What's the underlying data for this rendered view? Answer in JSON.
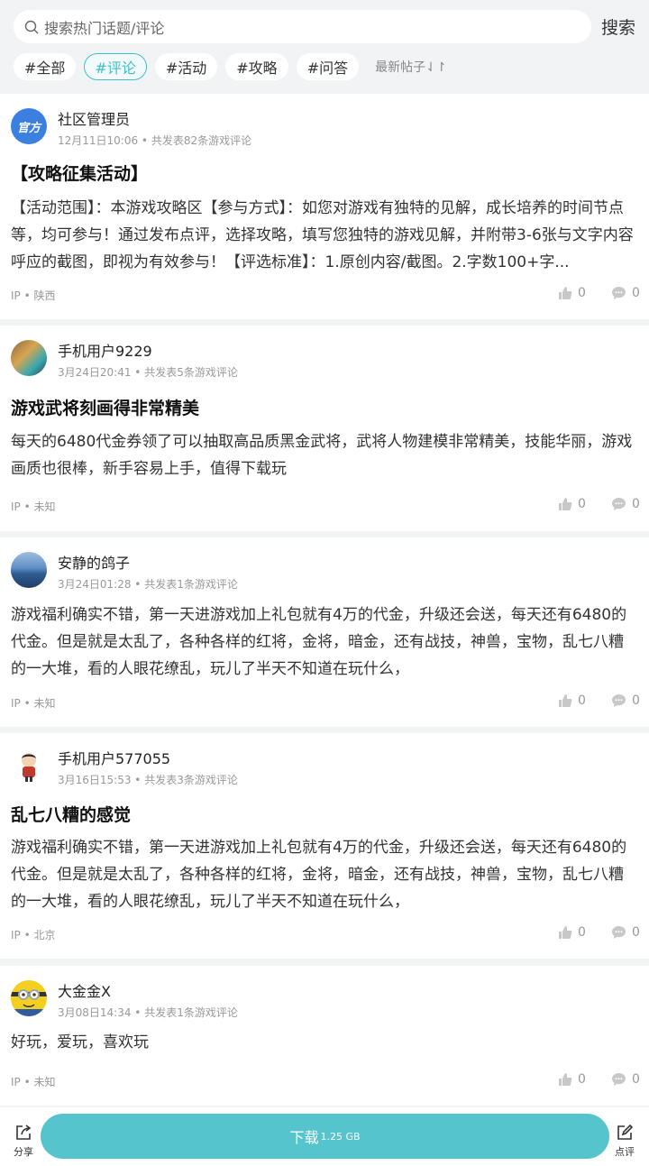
{
  "search": {
    "placeholder": "搜索热门话题/评论",
    "button": "搜索"
  },
  "tabs": [
    "#全部",
    "#评论",
    "#活动",
    "#攻略",
    "#问答"
  ],
  "sort_label": "最新帖子⇃↾",
  "posts": [
    {
      "user": "社区管理员",
      "avatar_text": "官方",
      "meta": "12月11日10:06 • 共发表82条游戏评论",
      "title": "【攻略征集活动】",
      "content": "【活动范围】：本游戏攻略区【参与方式】：如您对游戏有独特的见解，成长培养的时间节点等，均可参与！通过发布点评，选择攻略，填写您独特的游戏见解，并附带3-6张与文字内容呼应的截图，即视为有效参与！【评选标准】：1.原创内容/截图。2.字数100+字...",
      "ip": "IP • 陕西",
      "likes": "0",
      "comments": "0"
    },
    {
      "user": "手机用户9229",
      "meta": "3月24日20:41 • 共发表5条游戏评论",
      "title": "游戏武将刻画得非常精美",
      "content": "每天的6480代金券领了可以抽取高品质黑金武将，武将人物建模非常精美，技能华丽，游戏画质也很棒，新手容易上手，值得下载玩",
      "ip": "IP • 未知",
      "likes": "0",
      "comments": "0"
    },
    {
      "user": "安静的鸽子",
      "meta": "3月24日01:28 • 共发表1条游戏评论",
      "title": "",
      "content": "游戏福利确实不错，第一天进游戏加上礼包就有4万的代金，升级还会送，每天还有6480的代金。但是就是太乱了，各种各样的红将，金将，暗金，还有战技，神兽，宝物，乱七八糟的一大堆，看的人眼花缭乱，玩儿了半天不知道在玩什么，",
      "ip": "IP • 未知",
      "likes": "0",
      "comments": "0"
    },
    {
      "user": "手机用户577055",
      "meta": "3月16日15:53 • 共发表3条游戏评论",
      "title": "乱七八糟的感觉",
      "content": "游戏福利确实不错，第一天进游戏加上礼包就有4万的代金，升级还会送，每天还有6480的代金。但是就是太乱了，各种各样的红将，金将，暗金，还有战技，神兽，宝物，乱七八糟的一大堆，看的人眼花缭乱，玩儿了半天不知道在玩什么，",
      "ip": "IP • 北京",
      "likes": "0",
      "comments": "0"
    },
    {
      "user": "大金金X",
      "meta": "3月08日14:34 • 共发表1条游戏评论",
      "title": "",
      "content": "好玩，爱玩，喜欢玩",
      "ip": "IP • 未知",
      "likes": "0",
      "comments": "0"
    }
  ],
  "bottom": {
    "share": "分享",
    "download": "下载",
    "size": "1.25 GB",
    "review": "点评"
  },
  "colors": {
    "accent": "#45bcc7",
    "download_bg": "#56c4cc"
  }
}
